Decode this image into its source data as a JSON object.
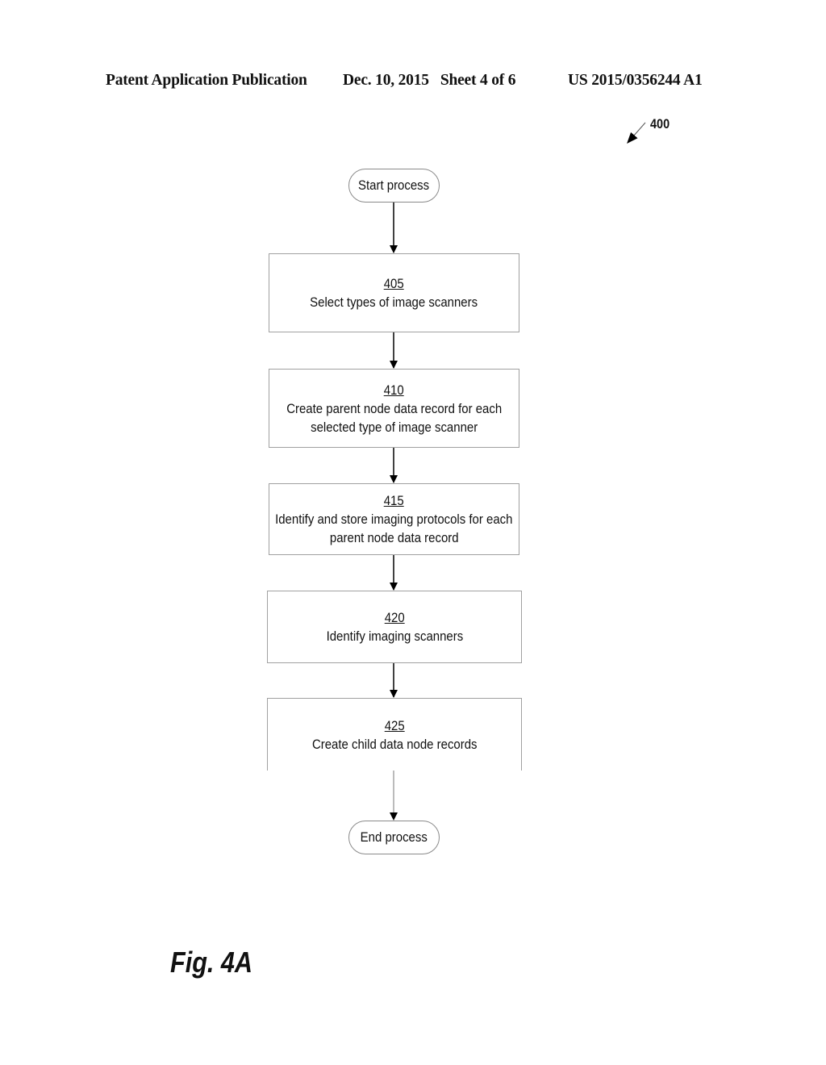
{
  "header": {
    "publication_type": "Patent Application Publication",
    "date_sheet": "Dec. 10, 2015   Sheet 4 of 6",
    "publication_number": "US 2015/0356244 A1"
  },
  "figure": {
    "reference_number": "400",
    "label": "Fig. 4A"
  },
  "flowchart": {
    "start": "Start process",
    "steps": [
      {
        "number": "405",
        "lines": [
          "Select types of image scanners"
        ]
      },
      {
        "number": "410",
        "lines": [
          "Create parent node data record for each",
          "selected type of image scanner"
        ]
      },
      {
        "number": "415",
        "lines": [
          "Identify and store imaging protocols for each",
          "parent node data record"
        ]
      },
      {
        "number": "420",
        "lines": [
          "Identify imaging scanners"
        ]
      },
      {
        "number": "425",
        "lines": [
          "Create child data node records"
        ]
      }
    ],
    "end": "End process"
  }
}
